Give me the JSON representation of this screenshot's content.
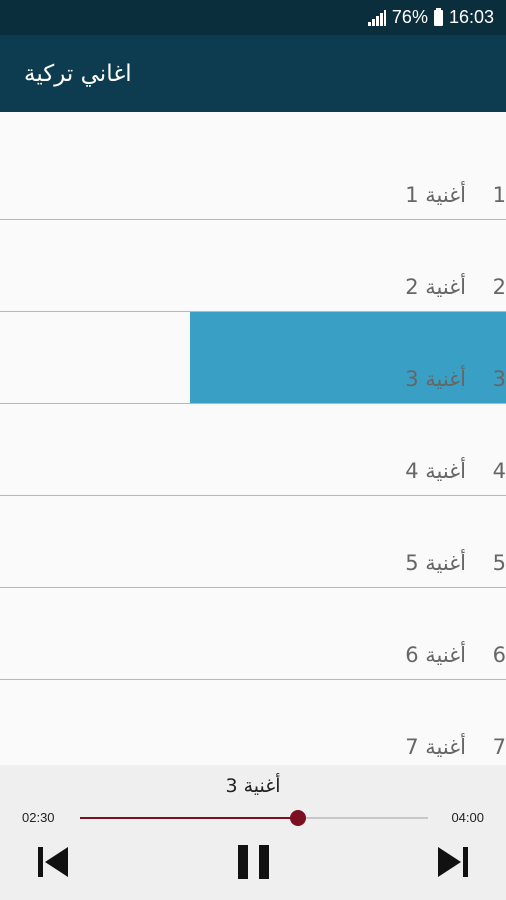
{
  "status_bar": {
    "battery": "76%",
    "time": "16:03"
  },
  "app_bar": {
    "title": "اغاني تركية"
  },
  "songs": [
    {
      "number": "1",
      "name": "أغنية 1"
    },
    {
      "number": "2",
      "name": "أغنية 2"
    },
    {
      "number": "3",
      "name": "أغنية 3",
      "selected": true
    },
    {
      "number": "4",
      "name": "أغنية 4"
    },
    {
      "number": "5",
      "name": "أغنية 5"
    },
    {
      "number": "6",
      "name": "أغنية 6"
    },
    {
      "number": "7",
      "name": "أغنية 7"
    }
  ],
  "player": {
    "now_playing": "أغنية 3",
    "elapsed": "02:30",
    "duration": "04:00",
    "progress": 0.625,
    "icons": {
      "previous": "skip-previous-icon",
      "pause": "pause-icon",
      "next": "skip-next-icon"
    }
  },
  "colors": {
    "status_bar": "#0b2e3d",
    "app_bar": "#0d3b4f",
    "selected_row": "#3a9fc4",
    "seek_accent": "#7b1022"
  }
}
